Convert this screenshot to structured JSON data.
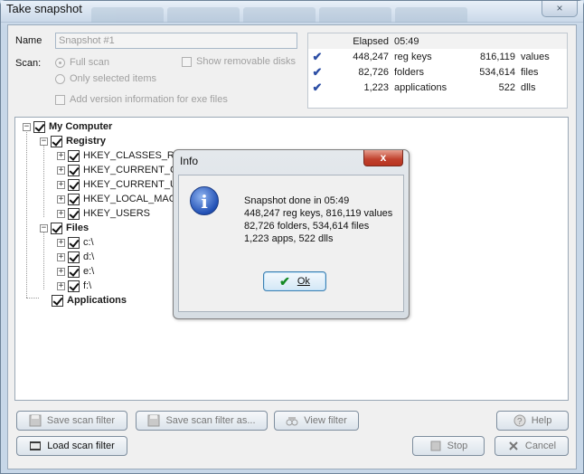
{
  "window": {
    "title": "Take snapshot",
    "close_label": "×"
  },
  "form": {
    "name_label": "Name",
    "name_value": "Snapshot #1",
    "scan_label": "Scan:",
    "full_scan": "Full scan",
    "only_selected": "Only selected items",
    "show_removable": "Show removable disks",
    "add_version": "Add version information for exe files"
  },
  "stats": {
    "elapsed_label": "Elapsed",
    "elapsed_value": "05:49",
    "rows": [
      {
        "count": "448,247",
        "label": "reg keys",
        "count2": "816,119",
        "label2": "values"
      },
      {
        "count": "82,726",
        "label": "folders",
        "count2": "534,614",
        "label2": "files"
      },
      {
        "count": "1,223",
        "label": "applications",
        "count2": "522",
        "label2": "dlls"
      }
    ]
  },
  "tree": {
    "root": "My Computer",
    "registry": "Registry",
    "hkeys": [
      "HKEY_CLASSES_ROOT",
      "HKEY_CURRENT_CONFIG",
      "HKEY_CURRENT_USER",
      "HKEY_LOCAL_MACHINE",
      "HKEY_USERS"
    ],
    "files": "Files",
    "drives": [
      "c:\\",
      "d:\\",
      "e:\\",
      "f:\\"
    ],
    "applications": "Applications"
  },
  "buttons": {
    "save_filter": "Save scan filter",
    "save_filter_as": "Save scan filter as...",
    "view_filter": "View filter",
    "load_filter": "Load scan filter",
    "help": "Help",
    "stop": "Stop",
    "cancel": "Cancel"
  },
  "dialog": {
    "title": "Info",
    "close": "x",
    "line1": "Snapshot done in 05:49",
    "line2": "448,247 reg keys, 816,119 values",
    "line3": "82,726 folders, 534,614 files",
    "line4": "1,223 apps, 522 dlls",
    "ok": "Ok"
  }
}
